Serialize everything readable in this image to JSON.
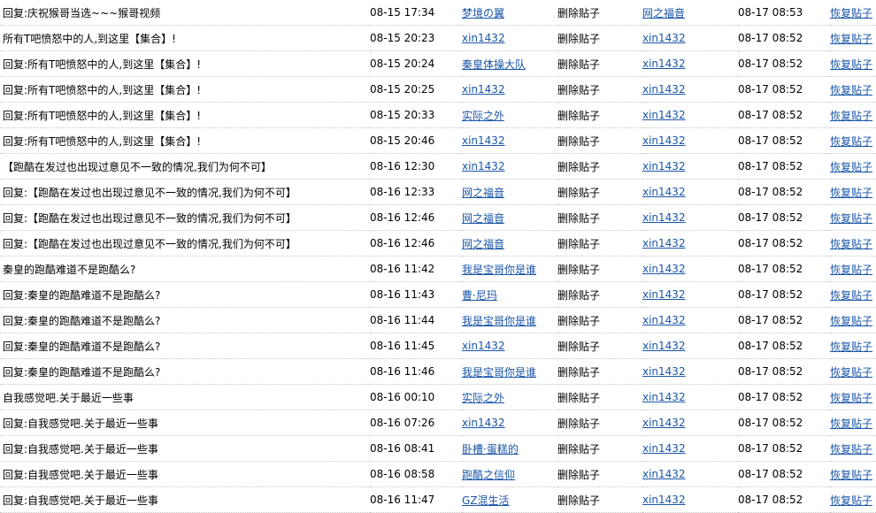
{
  "log": {
    "rows": [
      {
        "title": "回复:庆祝猴哥当选~~~猴哥视频",
        "post_time": "08-15 17:34",
        "author": "梦境の翼",
        "action": "删除贴子",
        "operator": "网之福音",
        "op_time": "08-17 08:53",
        "restore": "恢复贴子"
      },
      {
        "title": "所有T吧愤怒中的人,到这里【集合】!",
        "post_time": "08-15 20:23",
        "author": "xin1432",
        "action": "删除贴子",
        "operator": "xin1432",
        "op_time": "08-17 08:52",
        "restore": "恢复贴子"
      },
      {
        "title": "回复:所有T吧愤怒中的人,到这里【集合】!",
        "post_time": "08-15 20:24",
        "author": "秦皇体操大队",
        "action": "删除贴子",
        "operator": "xin1432",
        "op_time": "08-17 08:52",
        "restore": "恢复贴子"
      },
      {
        "title": "回复:所有T吧愤怒中的人,到这里【集合】!",
        "post_time": "08-15 20:25",
        "author": "xin1432",
        "action": "删除贴子",
        "operator": "xin1432",
        "op_time": "08-17 08:52",
        "restore": "恢复贴子"
      },
      {
        "title": "回复:所有T吧愤怒中的人,到这里【集合】!",
        "post_time": "08-15 20:33",
        "author": "实际之外",
        "action": "删除贴子",
        "operator": "xin1432",
        "op_time": "08-17 08:52",
        "restore": "恢复贴子"
      },
      {
        "title": "回复:所有T吧愤怒中的人,到这里【集合】!",
        "post_time": "08-15 20:46",
        "author": "xin1432",
        "action": "删除贴子",
        "operator": "xin1432",
        "op_time": "08-17 08:52",
        "restore": "恢复贴子"
      },
      {
        "title": "【跑酷在发过也出现过意见不一致的情况,我们为何不可】",
        "post_time": "08-16 12:30",
        "author": "xin1432",
        "action": "删除贴子",
        "operator": "xin1432",
        "op_time": "08-17 08:52",
        "restore": "恢复贴子"
      },
      {
        "title": "回复:【跑酷在发过也出现过意见不一致的情况,我们为何不可】",
        "post_time": "08-16 12:33",
        "author": "网之福音",
        "action": "删除贴子",
        "operator": "xin1432",
        "op_time": "08-17 08:52",
        "restore": "恢复贴子"
      },
      {
        "title": "回复:【跑酷在发过也出现过意见不一致的情况,我们为何不可】",
        "post_time": "08-16 12:46",
        "author": "网之福音",
        "action": "删除贴子",
        "operator": "xin1432",
        "op_time": "08-17 08:52",
        "restore": "恢复贴子"
      },
      {
        "title": "回复:【跑酷在发过也出现过意见不一致的情况,我们为何不可】",
        "post_time": "08-16 12:46",
        "author": "网之福音",
        "action": "删除贴子",
        "operator": "xin1432",
        "op_time": "08-17 08:52",
        "restore": "恢复贴子"
      },
      {
        "title": "秦皇的跑酷难道不是跑酷么?",
        "post_time": "08-16 11:42",
        "author": "我是宝哥你是谁",
        "action": "删除贴子",
        "operator": "xin1432",
        "op_time": "08-17 08:52",
        "restore": "恢复贴子"
      },
      {
        "title": "回复:秦皇的跑酷难道不是跑酷么?",
        "post_time": "08-16 11:43",
        "author": "曹·尼玛",
        "action": "删除贴子",
        "operator": "xin1432",
        "op_time": "08-17 08:52",
        "restore": "恢复贴子"
      },
      {
        "title": "回复:秦皇的跑酷难道不是跑酷么?",
        "post_time": "08-16 11:44",
        "author": "我是宝哥你是谁",
        "action": "删除贴子",
        "operator": "xin1432",
        "op_time": "08-17 08:52",
        "restore": "恢复贴子"
      },
      {
        "title": "回复:秦皇的跑酷难道不是跑酷么?",
        "post_time": "08-16 11:45",
        "author": "xin1432",
        "action": "删除贴子",
        "operator": "xin1432",
        "op_time": "08-17 08:52",
        "restore": "恢复贴子"
      },
      {
        "title": "回复:秦皇的跑酷难道不是跑酷么?",
        "post_time": "08-16 11:46",
        "author": "我是宝哥你是谁",
        "action": "删除贴子",
        "operator": "xin1432",
        "op_time": "08-17 08:52",
        "restore": "恢复贴子"
      },
      {
        "title": "自我感觉吧.关于最近一些事",
        "post_time": "08-16 00:10",
        "author": "实际之外",
        "action": "删除贴子",
        "operator": "xin1432",
        "op_time": "08-17 08:52",
        "restore": "恢复贴子"
      },
      {
        "title": "回复:自我感觉吧.关于最近一些事",
        "post_time": "08-16 07:26",
        "author": "xin1432",
        "action": "删除贴子",
        "operator": "xin1432",
        "op_time": "08-17 08:52",
        "restore": "恢复贴子"
      },
      {
        "title": "回复:自我感觉吧.关于最近一些事",
        "post_time": "08-16 08:41",
        "author": "卧槽·蛋糕的",
        "action": "删除贴子",
        "operator": "xin1432",
        "op_time": "08-17 08:52",
        "restore": "恢复贴子"
      },
      {
        "title": "回复:自我感觉吧.关于最近一些事",
        "post_time": "08-16 08:58",
        "author": "跑酷之信仰",
        "action": "删除贴子",
        "operator": "xin1432",
        "op_time": "08-17 08:52",
        "restore": "恢复贴子"
      },
      {
        "title": "回复:自我感觉吧.关于最近一些事",
        "post_time": "08-16 11:47",
        "author": "GZ混生活",
        "action": "删除贴子",
        "operator": "xin1432",
        "op_time": "08-17 08:52",
        "restore": "恢复贴子"
      }
    ]
  }
}
